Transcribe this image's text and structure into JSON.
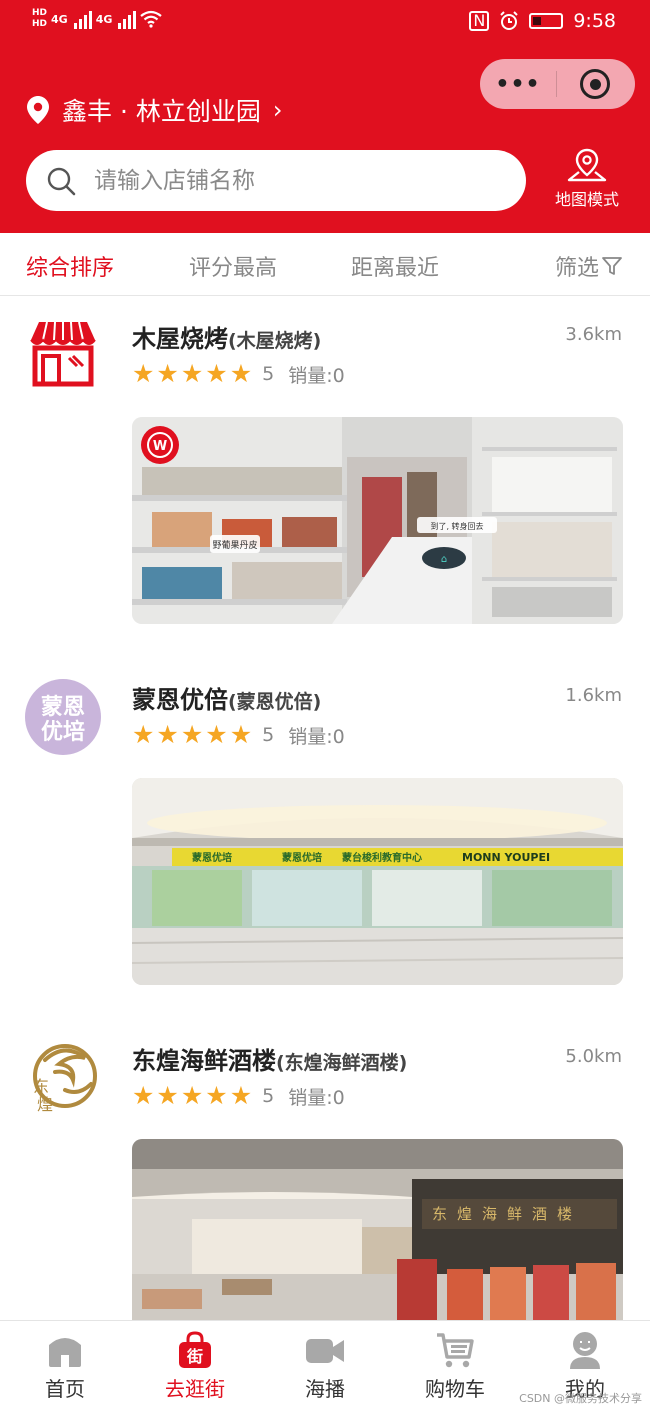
{
  "status_bar": {
    "network_left": "HD",
    "network_right": "4G",
    "time": "9:58"
  },
  "capsule": {
    "more_label": "•••"
  },
  "header": {
    "location": "鑫丰 · 林立创业园",
    "search_placeholder": "请输入店铺名称",
    "map_mode_label": "地图模式"
  },
  "sort_tabs": [
    {
      "label": "综合排序",
      "active": true
    },
    {
      "label": "评分最高",
      "active": false
    },
    {
      "label": "距离最近",
      "active": false
    },
    {
      "label": "筛选",
      "active": false
    }
  ],
  "shops": [
    {
      "name": "木屋烧烤",
      "name_suffix": "(木屋烧烤)",
      "distance": "3.6km",
      "stars": 5,
      "score": "5",
      "sales": "销量:0",
      "logo": "storefront-icon",
      "photo_labels": [
        "野葡果丹皮",
        "到了, 转身回去"
      ]
    },
    {
      "name": "蒙恩优倍",
      "name_suffix": "(蒙恩优倍)",
      "distance": "1.6km",
      "stars": 5,
      "score": "5",
      "sales": "销量:0",
      "logo_text": [
        "蒙恩",
        "优培"
      ],
      "photo_labels": [
        "蒙恩优培",
        "蒙恩优培",
        "蒙台梭利教育中心",
        "MONN YOUPEI"
      ]
    },
    {
      "name": "东煌海鲜酒楼",
      "name_suffix": "(东煌海鲜酒楼)",
      "distance": "5.0km",
      "stars": 5,
      "score": "5",
      "sales": "销量:0",
      "logo_text": [
        "东",
        "煌"
      ],
      "photo_labels": [
        "东煌海鲜酒楼"
      ]
    }
  ],
  "tabbar": [
    {
      "label": "首页",
      "icon": "home-icon",
      "active": false
    },
    {
      "label": "去逛街",
      "icon": "shopping-bag-icon",
      "active": true
    },
    {
      "label": "海播",
      "icon": "video-camera-icon",
      "active": false
    },
    {
      "label": "购物车",
      "icon": "cart-icon",
      "active": false
    },
    {
      "label": "我的",
      "icon": "user-icon",
      "active": false
    }
  ],
  "watermark": "CSDN @微服务技术分享",
  "colors": {
    "brand_red": "#e0101f",
    "star": "#f5a623",
    "capsule": "#f3a7b1"
  }
}
